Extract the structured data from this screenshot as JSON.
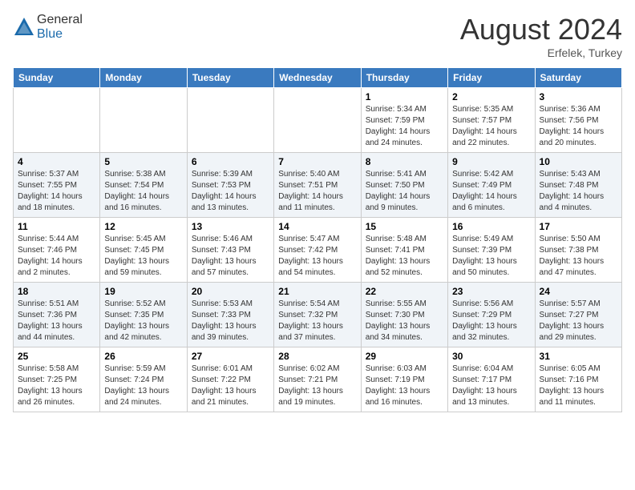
{
  "header": {
    "logo_general": "General",
    "logo_blue": "Blue",
    "month_year": "August 2024",
    "location": "Erfelek, Turkey"
  },
  "days_of_week": [
    "Sunday",
    "Monday",
    "Tuesday",
    "Wednesday",
    "Thursday",
    "Friday",
    "Saturday"
  ],
  "weeks": [
    [
      {
        "day": "",
        "content": ""
      },
      {
        "day": "",
        "content": ""
      },
      {
        "day": "",
        "content": ""
      },
      {
        "day": "",
        "content": ""
      },
      {
        "day": "1",
        "content": "Sunrise: 5:34 AM\nSunset: 7:59 PM\nDaylight: 14 hours\nand 24 minutes."
      },
      {
        "day": "2",
        "content": "Sunrise: 5:35 AM\nSunset: 7:57 PM\nDaylight: 14 hours\nand 22 minutes."
      },
      {
        "day": "3",
        "content": "Sunrise: 5:36 AM\nSunset: 7:56 PM\nDaylight: 14 hours\nand 20 minutes."
      }
    ],
    [
      {
        "day": "4",
        "content": "Sunrise: 5:37 AM\nSunset: 7:55 PM\nDaylight: 14 hours\nand 18 minutes."
      },
      {
        "day": "5",
        "content": "Sunrise: 5:38 AM\nSunset: 7:54 PM\nDaylight: 14 hours\nand 16 minutes."
      },
      {
        "day": "6",
        "content": "Sunrise: 5:39 AM\nSunset: 7:53 PM\nDaylight: 14 hours\nand 13 minutes."
      },
      {
        "day": "7",
        "content": "Sunrise: 5:40 AM\nSunset: 7:51 PM\nDaylight: 14 hours\nand 11 minutes."
      },
      {
        "day": "8",
        "content": "Sunrise: 5:41 AM\nSunset: 7:50 PM\nDaylight: 14 hours\nand 9 minutes."
      },
      {
        "day": "9",
        "content": "Sunrise: 5:42 AM\nSunset: 7:49 PM\nDaylight: 14 hours\nand 6 minutes."
      },
      {
        "day": "10",
        "content": "Sunrise: 5:43 AM\nSunset: 7:48 PM\nDaylight: 14 hours\nand 4 minutes."
      }
    ],
    [
      {
        "day": "11",
        "content": "Sunrise: 5:44 AM\nSunset: 7:46 PM\nDaylight: 14 hours\nand 2 minutes."
      },
      {
        "day": "12",
        "content": "Sunrise: 5:45 AM\nSunset: 7:45 PM\nDaylight: 13 hours\nand 59 minutes."
      },
      {
        "day": "13",
        "content": "Sunrise: 5:46 AM\nSunset: 7:43 PM\nDaylight: 13 hours\nand 57 minutes."
      },
      {
        "day": "14",
        "content": "Sunrise: 5:47 AM\nSunset: 7:42 PM\nDaylight: 13 hours\nand 54 minutes."
      },
      {
        "day": "15",
        "content": "Sunrise: 5:48 AM\nSunset: 7:41 PM\nDaylight: 13 hours\nand 52 minutes."
      },
      {
        "day": "16",
        "content": "Sunrise: 5:49 AM\nSunset: 7:39 PM\nDaylight: 13 hours\nand 50 minutes."
      },
      {
        "day": "17",
        "content": "Sunrise: 5:50 AM\nSunset: 7:38 PM\nDaylight: 13 hours\nand 47 minutes."
      }
    ],
    [
      {
        "day": "18",
        "content": "Sunrise: 5:51 AM\nSunset: 7:36 PM\nDaylight: 13 hours\nand 44 minutes."
      },
      {
        "day": "19",
        "content": "Sunrise: 5:52 AM\nSunset: 7:35 PM\nDaylight: 13 hours\nand 42 minutes."
      },
      {
        "day": "20",
        "content": "Sunrise: 5:53 AM\nSunset: 7:33 PM\nDaylight: 13 hours\nand 39 minutes."
      },
      {
        "day": "21",
        "content": "Sunrise: 5:54 AM\nSunset: 7:32 PM\nDaylight: 13 hours\nand 37 minutes."
      },
      {
        "day": "22",
        "content": "Sunrise: 5:55 AM\nSunset: 7:30 PM\nDaylight: 13 hours\nand 34 minutes."
      },
      {
        "day": "23",
        "content": "Sunrise: 5:56 AM\nSunset: 7:29 PM\nDaylight: 13 hours\nand 32 minutes."
      },
      {
        "day": "24",
        "content": "Sunrise: 5:57 AM\nSunset: 7:27 PM\nDaylight: 13 hours\nand 29 minutes."
      }
    ],
    [
      {
        "day": "25",
        "content": "Sunrise: 5:58 AM\nSunset: 7:25 PM\nDaylight: 13 hours\nand 26 minutes."
      },
      {
        "day": "26",
        "content": "Sunrise: 5:59 AM\nSunset: 7:24 PM\nDaylight: 13 hours\nand 24 minutes."
      },
      {
        "day": "27",
        "content": "Sunrise: 6:01 AM\nSunset: 7:22 PM\nDaylight: 13 hours\nand 21 minutes."
      },
      {
        "day": "28",
        "content": "Sunrise: 6:02 AM\nSunset: 7:21 PM\nDaylight: 13 hours\nand 19 minutes."
      },
      {
        "day": "29",
        "content": "Sunrise: 6:03 AM\nSunset: 7:19 PM\nDaylight: 13 hours\nand 16 minutes."
      },
      {
        "day": "30",
        "content": "Sunrise: 6:04 AM\nSunset: 7:17 PM\nDaylight: 13 hours\nand 13 minutes."
      },
      {
        "day": "31",
        "content": "Sunrise: 6:05 AM\nSunset: 7:16 PM\nDaylight: 13 hours\nand 11 minutes."
      }
    ]
  ]
}
